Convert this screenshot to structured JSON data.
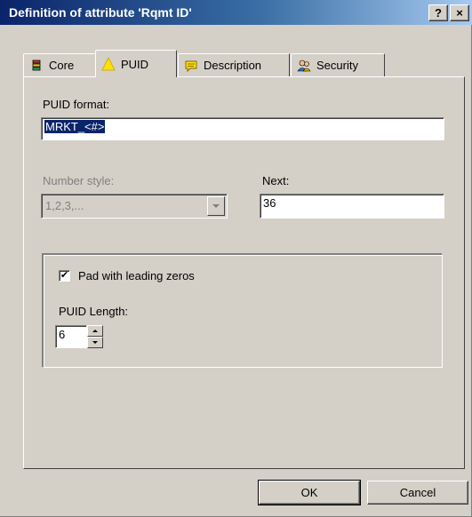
{
  "window": {
    "title": "Definition of attribute 'Rqmt ID'",
    "help_label": "?",
    "close_label": "×"
  },
  "tabs": [
    {
      "label": "Core",
      "icon": "core-icon",
      "active": false
    },
    {
      "label": "PUID",
      "icon": "warning-triangle-icon",
      "active": true
    },
    {
      "label": "Description",
      "icon": "description-icon",
      "active": false
    },
    {
      "label": "Security",
      "icon": "security-users-icon",
      "active": false
    }
  ],
  "puid_format": {
    "label": "PUID format:",
    "value": "MRKT_<#>"
  },
  "number_style": {
    "label": "Number style:",
    "value": "1,2,3,...",
    "disabled": true
  },
  "next": {
    "label": "Next:",
    "value": "36"
  },
  "padding": {
    "checkbox_label": "Pad with leading zeros",
    "checked": true,
    "length_label": "PUID Length:",
    "length_value": "6"
  },
  "buttons": {
    "ok": "OK",
    "cancel": "Cancel"
  },
  "colors": {
    "titlebar_start": "#0a246a",
    "titlebar_end": "#a6caf0",
    "face": "#d4d0c8",
    "selection": "#0a246a"
  }
}
